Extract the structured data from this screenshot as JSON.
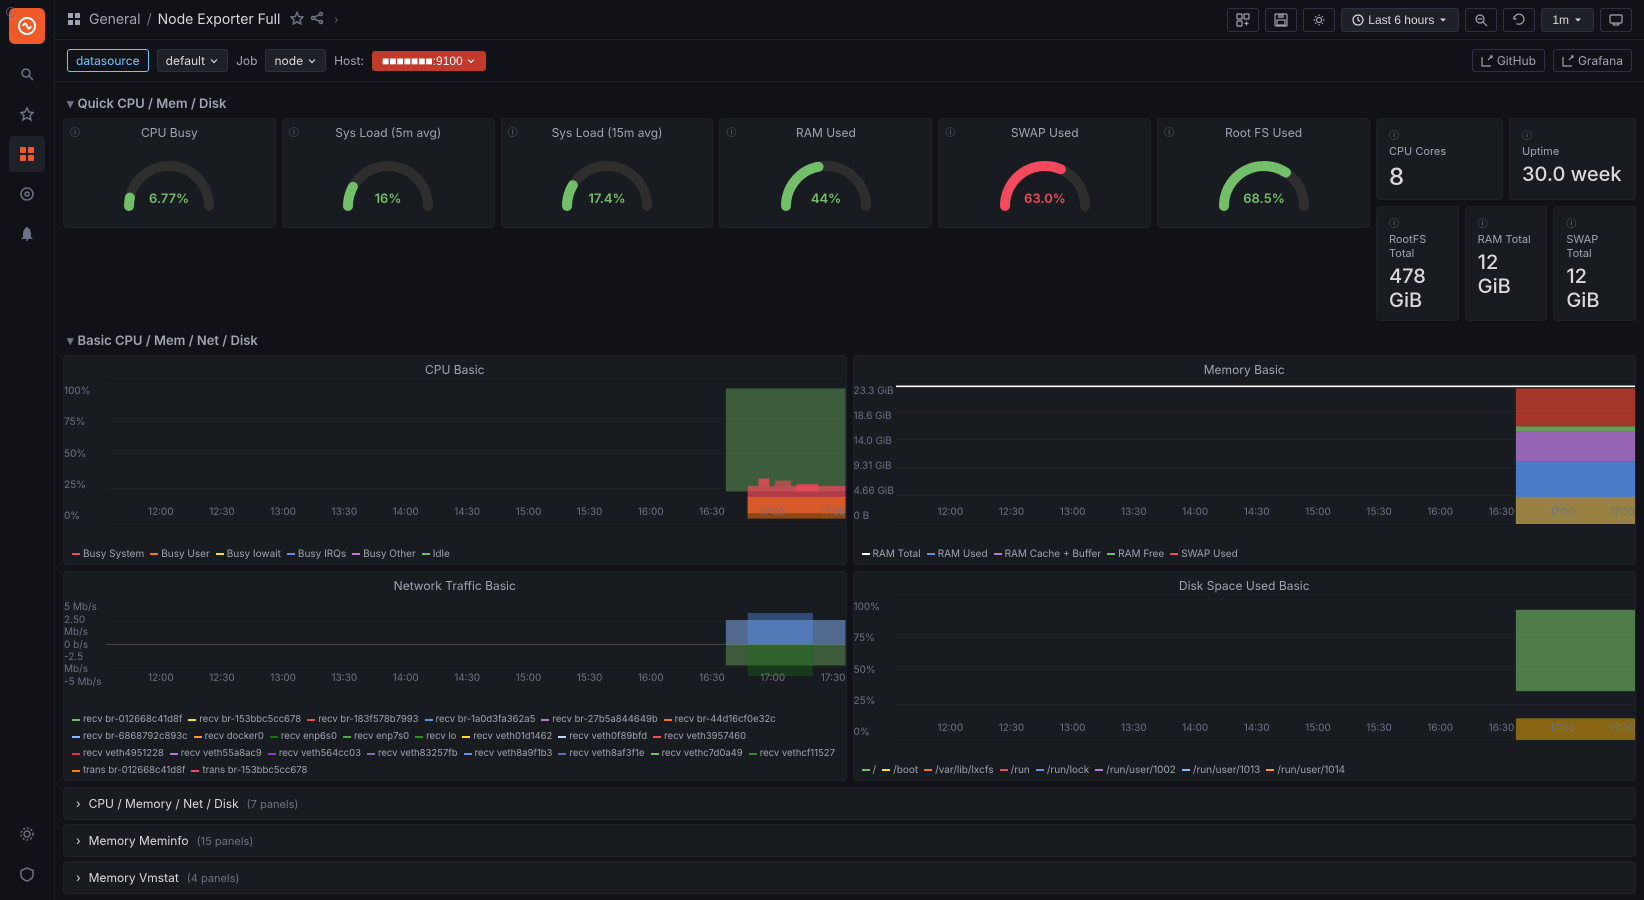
{
  "sidebar": {
    "items": [
      {
        "name": "home",
        "icon": "⊞",
        "active": false
      },
      {
        "name": "search",
        "icon": "🔍",
        "active": false
      },
      {
        "name": "starred",
        "icon": "★",
        "active": false
      },
      {
        "name": "dashboards",
        "icon": "▦",
        "active": true
      },
      {
        "name": "explore",
        "icon": "◎",
        "active": false
      },
      {
        "name": "alerting",
        "icon": "🔔",
        "active": false
      }
    ],
    "bottom": [
      {
        "name": "admin",
        "icon": "⚙"
      },
      {
        "name": "shield",
        "icon": "🛡"
      }
    ]
  },
  "topbar": {
    "breadcrumb": [
      "General",
      "Node Exporter Full"
    ],
    "buttons": {
      "add_panel": "add-panel",
      "save": "save",
      "settings": "settings",
      "time_range": "Last 6 hours",
      "zoom_out": "zoom-out",
      "refresh_interval": "1m",
      "tv_mode": "tv"
    }
  },
  "filterbar": {
    "datasource_label": "datasource",
    "datasource_value": "default",
    "job_label": "Job",
    "job_value": "node",
    "host_label": "Host:",
    "host_value": ":9100",
    "github_link": "GitHub",
    "grafana_link": "Grafana"
  },
  "sections": {
    "quick": {
      "title": "Quick CPU / Mem / Disk",
      "collapsed": false,
      "gauges": [
        {
          "title": "CPU Busy",
          "value": "6.77%",
          "pct": 6.77,
          "color": "#73bf69"
        },
        {
          "title": "Sys Load (5m avg)",
          "value": "16%",
          "pct": 16,
          "color": "#73bf69"
        },
        {
          "title": "Sys Load (15m avg)",
          "value": "17.4%",
          "pct": 17.4,
          "color": "#73bf69"
        },
        {
          "title": "RAM Used",
          "value": "44%",
          "pct": 44,
          "color": "#73bf69"
        },
        {
          "title": "SWAP Used",
          "value": "63.0%",
          "pct": 63,
          "color": "#f2495c"
        },
        {
          "title": "Root FS Used",
          "value": "68.5%",
          "pct": 68.5,
          "color": "#73bf69"
        }
      ],
      "stats": [
        {
          "title": "CPU Cores",
          "value": "8"
        },
        {
          "title": "Uptime",
          "value": "30.0 week"
        },
        {
          "title": "RootFS Total",
          "value": "478 GiB"
        },
        {
          "title": "RAM Total",
          "value": "12 GiB"
        },
        {
          "title": "SWAP Total",
          "value": "12 GiB"
        }
      ]
    },
    "basic": {
      "title": "Basic CPU / Mem / Net / Disk",
      "collapsed": false,
      "cpu_chart": {
        "title": "CPU Basic",
        "y_labels": [
          "100%",
          "75%",
          "50%",
          "25%",
          "0%"
        ],
        "x_labels": [
          "12:00",
          "12:30",
          "13:00",
          "13:30",
          "14:00",
          "14:30",
          "15:00",
          "15:30",
          "16:00",
          "16:30",
          "17:00",
          "17:30"
        ],
        "legend": [
          {
            "label": "Busy System",
            "color": "#f2495c"
          },
          {
            "label": "Busy User",
            "color": "#ff780a"
          },
          {
            "label": "Busy Iowait",
            "color": "#fade2a"
          },
          {
            "label": "Busy IRQs",
            "color": "#5794f2"
          },
          {
            "label": "Busy Other",
            "color": "#b877d9"
          },
          {
            "label": "Idle",
            "color": "#73bf69"
          }
        ]
      },
      "memory_chart": {
        "title": "Memory Basic",
        "y_labels": [
          "23.3 GiB",
          "18.6 GiB",
          "14.0 GiB",
          "9.31 GiB",
          "4.66 GiB",
          "0 B"
        ],
        "x_labels": [
          "12:00",
          "12:30",
          "13:00",
          "13:30",
          "14:00",
          "14:30",
          "15:00",
          "15:30",
          "16:00",
          "16:30",
          "17:00",
          "17:30"
        ],
        "legend": [
          {
            "label": "RAM Total",
            "color": "#ffffff"
          },
          {
            "label": "RAM Used",
            "color": "#5794f2"
          },
          {
            "label": "RAM Cache + Buffer",
            "color": "#b877d9"
          },
          {
            "label": "RAM Free",
            "color": "#73bf69"
          },
          {
            "label": "SWAP Used",
            "color": "#f2495c"
          }
        ]
      },
      "network_chart": {
        "title": "Network Traffic Basic",
        "y_labels": [
          "5 Mb/s",
          "2.50 Mb/s",
          "0 b/s",
          "-2.5 Mb/s",
          "-5 Mb/s"
        ],
        "x_labels": [
          "12:00",
          "12:30",
          "13:00",
          "13:30",
          "14:00",
          "14:30",
          "15:00",
          "15:30",
          "16:00",
          "16:30",
          "17:00",
          "17:30"
        ],
        "legend": [
          {
            "label": "recv br-012668c41d8f",
            "color": "#73bf69"
          },
          {
            "label": "recv br-153bbc5cc678",
            "color": "#fade2a"
          },
          {
            "label": "recv br-183f578b7993",
            "color": "#f2495c"
          },
          {
            "label": "recv br-1a0d3fa362a5",
            "color": "#5794f2"
          },
          {
            "label": "recv br-27b5a844649b",
            "color": "#b877d9"
          },
          {
            "label": "recv br-44d16cf0e32c",
            "color": "#ff780a"
          },
          {
            "label": "recv br-6868792c893c",
            "color": "#8ab8ff"
          },
          {
            "label": "recv docker0",
            "color": "#ff9830"
          },
          {
            "label": "recv enp6s0",
            "color": "#19730e"
          },
          {
            "label": "recv enp7s0",
            "color": "#56a64b"
          },
          {
            "label": "recv lo",
            "color": "#37872d"
          },
          {
            "label": "recv veth01d1462",
            "color": "#fade2a"
          },
          {
            "label": "recv veth0f89bfd",
            "color": "#c0d8ff"
          },
          {
            "label": "recv veth3957460",
            "color": "#f2495c"
          },
          {
            "label": "recv veth4951228",
            "color": "#e02f44"
          },
          {
            "label": "recv veth55a8ac9",
            "color": "#b877d9"
          },
          {
            "label": "recv veth564cc03",
            "color": "#8f3bb8"
          },
          {
            "label": "recv veth83257fb",
            "color": "#806eb7"
          },
          {
            "label": "recv veth8a9f1b3",
            "color": "#5794f2"
          },
          {
            "label": "recv veth8af3f1e",
            "color": "#5f6fc4"
          },
          {
            "label": "recv vethc7d0a49",
            "color": "#73bf69"
          },
          {
            "label": "recv vethcf11527",
            "color": "#37872d"
          },
          {
            "label": "trans br-012668c41d8f",
            "color": "#ff780a"
          },
          {
            "label": "trans br-153bbc5cc678",
            "color": "#f2495c"
          }
        ]
      },
      "disk_chart": {
        "title": "Disk Space Used Basic",
        "y_labels": [
          "100%",
          "75%",
          "50%",
          "25%",
          "0%"
        ],
        "x_labels": [
          "12:00",
          "12:30",
          "13:00",
          "13:30",
          "14:00",
          "14:30",
          "15:00",
          "15:30",
          "16:00",
          "16:30",
          "17:00",
          "17:30"
        ],
        "legend": [
          {
            "label": "/",
            "color": "#73bf69"
          },
          {
            "label": "/boot",
            "color": "#fade2a"
          },
          {
            "label": "/var/lib/lxcfs",
            "color": "#ff780a"
          },
          {
            "label": "/run",
            "color": "#f2495c"
          },
          {
            "label": "/run/lock",
            "color": "#5794f2"
          },
          {
            "label": "/run/user/1002",
            "color": "#b877d9"
          },
          {
            "label": "/run/user/1013",
            "color": "#8ab8ff"
          },
          {
            "label": "/run/user/1014",
            "color": "#ff9830"
          }
        ]
      }
    },
    "collapsed_sections": [
      {
        "title": "CPU / Memory / Net / Disk",
        "badge": "(7 panels)"
      },
      {
        "title": "Memory Meminfo",
        "badge": "(15 panels)"
      },
      {
        "title": "Memory Vmstat",
        "badge": "(4 panels)"
      }
    ]
  }
}
